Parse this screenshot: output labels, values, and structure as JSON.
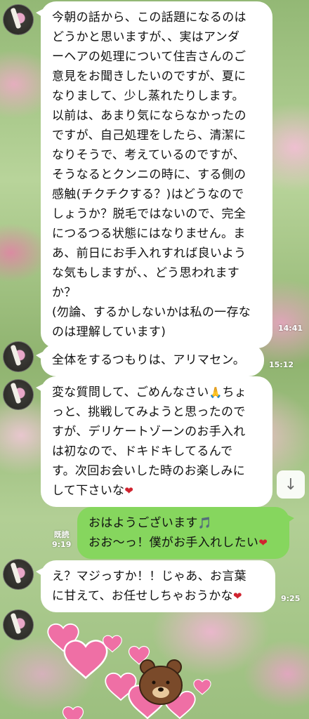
{
  "messages": [
    {
      "id": "m1",
      "lines": [
        "今朝の話から、この話題になるのは",
        "どうかと思いますが、、実はアンダ",
        "ーヘアの処理について住吉さんのご",
        "意見をお聞きしたいのですが、夏に",
        "なりまして、少し蒸れたりします。",
        "以前は、あまり気にならなかったの",
        "ですが、自己処理をしたら、清潔に",
        "なりそうで、考えているのですが、",
        "そうなるとクンニの時に、する側の",
        "感触(チクチクする？)はどうなので",
        "しょうか？脱毛ではないので、完全",
        "につるつる状態にはなりません。ま",
        "あ、前日にお手入れすれば良いよう",
        "な気もしますが、、どう思われます",
        "か？",
        "(勿論、するかしないかは私の一存な",
        "のは理解しています)"
      ],
      "time": "14:41"
    },
    {
      "id": "m2",
      "lines": [
        "全体をするつもりは、アリマセン。"
      ],
      "time": "15:12"
    },
    {
      "id": "m3",
      "lines": [
        "変な質問して、ごめんなさい",
        "っと、挑戦してみようと思ったので",
        "すが、デリケートゾーンのお手入れ",
        "は初なので、ドキドキしてるんで",
        "す。次回お会いした時のお楽しみに",
        "して下さいな"
      ],
      "line1_tail": "ちょ",
      "emoji_pray": "🙏",
      "emoji_heart": "❤"
    },
    {
      "id": "m4",
      "lines": [
        "おはようございます",
        "おお〜っ！僕がお手入れしたい"
      ],
      "emoji_note": "🎵",
      "emoji_heart": "❤",
      "read_label": "既読",
      "time": "9:19"
    },
    {
      "id": "m5",
      "lines": [
        "え？マジっすか！！じゃあ、お言葉",
        "に甘えて、お任せしちゃおうかな"
      ],
      "emoji_heart": "❤",
      "time": "9:25"
    }
  ],
  "scroll_button_icon": "↓",
  "colors": {
    "incoming_bubble": "#ffffff",
    "outgoing_bubble": "#86d65e",
    "heart": "#d0232f",
    "sticker_heart": "#ef6fa5"
  },
  "icons": [
    "avatar-icon",
    "arrow-down-icon",
    "hearts-bear-sticker"
  ]
}
